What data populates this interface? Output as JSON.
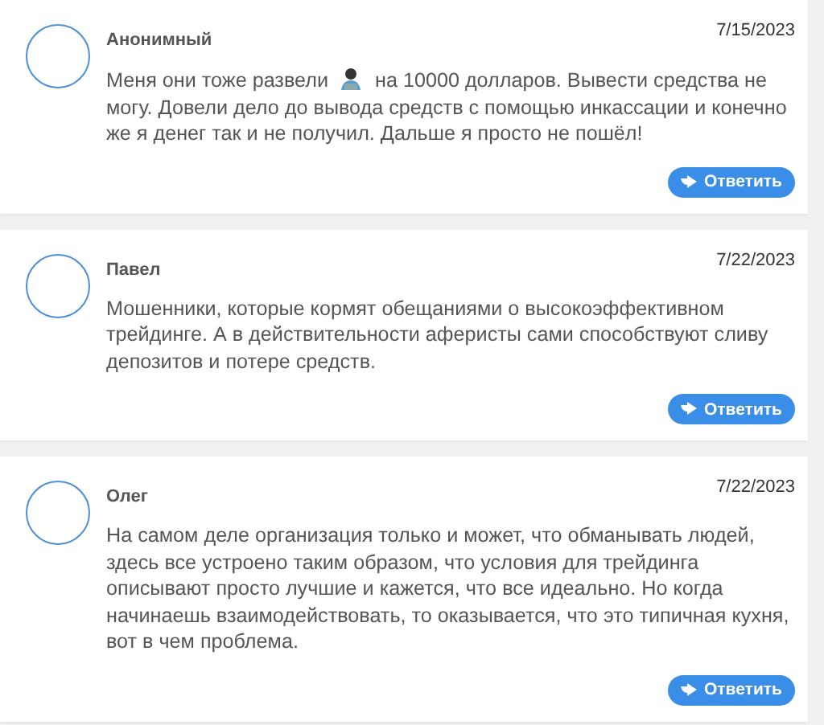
{
  "comments": [
    {
      "author": "Анонимный",
      "date": "7/15/2023",
      "body": [
        {
          "kind": "text",
          "text": "Меня они тоже развели"
        },
        {
          "kind": "icon"
        },
        {
          "kind": "text",
          "text": "на 10000 долларов. Вывести средства не могу. Довели дело до вывода средств с помощью инкассации и конечно же я денег так и не получил. Дальше я просто не пошёл!"
        }
      ],
      "reply": "Ответить"
    },
    {
      "author": "Павел",
      "date": "7/22/2023",
      "body": [
        {
          "kind": "text",
          "text": "Мошенники, которые кормят обещаниями о высокоэффективном трейдинге. А в действительности аферисты сами способствуют сливу депозитов и потере средств."
        }
      ],
      "reply": "Ответить"
    },
    {
      "author": "Олег",
      "date": "7/22/2023",
      "body": [
        {
          "kind": "text",
          "text": "На самом деле организация только и может, что обманывать людей, здесь все устроено таким образом, что условия для трейдинга описывают просто лучшие и кажется, что все идеально. Но когда начинаешь взаимодействовать, то оказывается, что это типичная кухня, вот в чем проблема."
        }
      ],
      "reply": "Ответить"
    }
  ]
}
